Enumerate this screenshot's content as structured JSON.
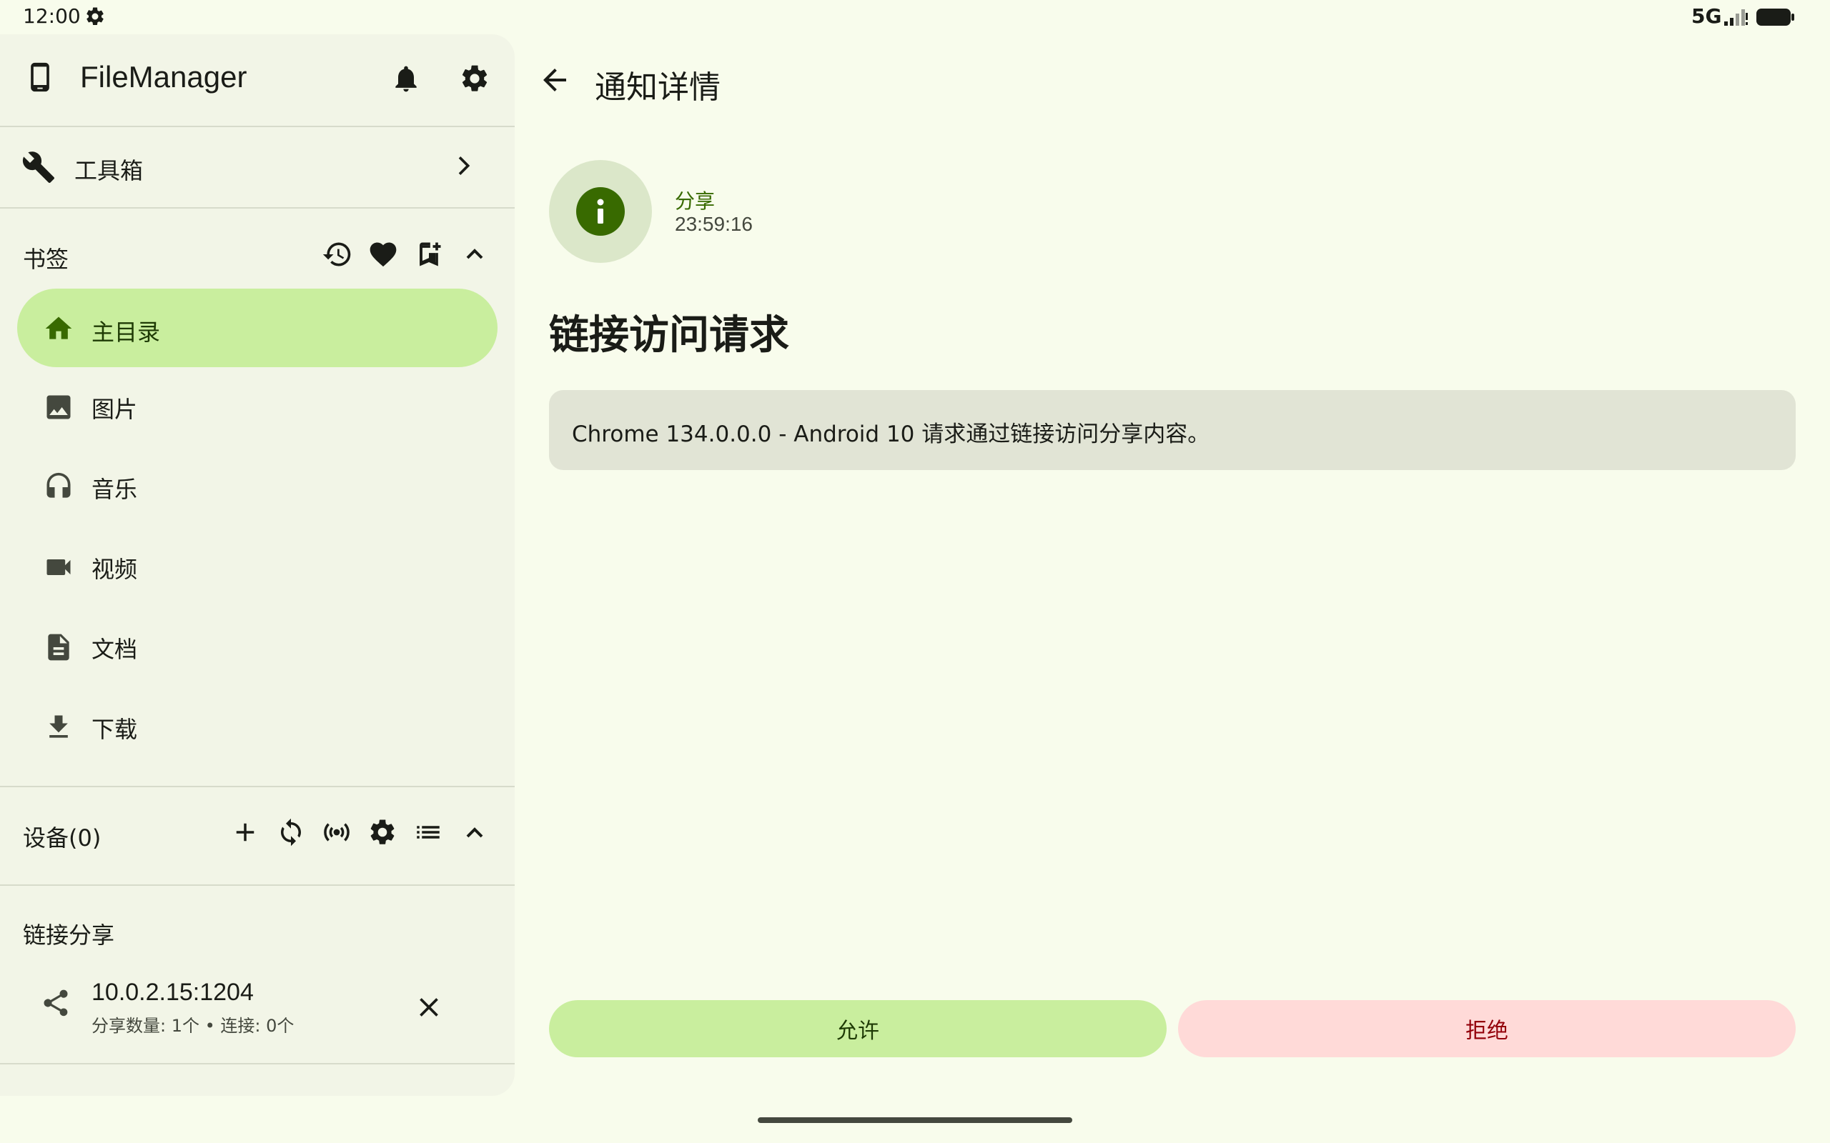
{
  "status_bar": {
    "time": "12:00",
    "network": "5G",
    "icons": [
      "settings-icon",
      "signal-icon",
      "battery-icon"
    ]
  },
  "sidebar": {
    "app_title": "FileManager",
    "header_icons": [
      "phone-icon",
      "bell-icon",
      "settings-icon"
    ],
    "toolbox": {
      "label": "工具箱",
      "icon": "wrench-icon"
    },
    "bookmarks": {
      "title": "书签",
      "actions": [
        "history-icon",
        "heart-icon",
        "bookmark-add-icon",
        "chevron-up-icon"
      ],
      "items": [
        {
          "label": "主目录",
          "icon": "home-icon",
          "active": true
        },
        {
          "label": "图片",
          "icon": "image-icon",
          "active": false
        },
        {
          "label": "音乐",
          "icon": "headphones-icon",
          "active": false
        },
        {
          "label": "视频",
          "icon": "video-icon",
          "active": false
        },
        {
          "label": "文档",
          "icon": "document-icon",
          "active": false
        },
        {
          "label": "下载",
          "icon": "download-icon",
          "active": false
        }
      ]
    },
    "devices": {
      "title": "设备(0)",
      "actions": [
        "add-icon",
        "sync-icon",
        "broadcast-icon",
        "settings-icon",
        "list-icon",
        "chevron-up-icon"
      ]
    },
    "link_share": {
      "title": "链接分享",
      "item": {
        "address": "10.0.2.15:1204",
        "subtitle": "分享数量: 1个 • 连接: 0个",
        "icon": "share-icon"
      }
    }
  },
  "main": {
    "title": "通知详情",
    "notification": {
      "category": "分享",
      "time": "23:59:16",
      "heading": "链接访问请求",
      "message": "Chrome 134.0.0.0 - Android 10 请求通过链接访问分享内容。"
    },
    "buttons": {
      "allow": "允许",
      "deny": "拒绝"
    }
  },
  "colors": {
    "background": "#f8fcec",
    "sidebar": "#f2f5e7",
    "primary": "#386a00",
    "primary_container": "#c9ee9e",
    "error_container": "#ffdad8",
    "error_text": "#93000a"
  }
}
